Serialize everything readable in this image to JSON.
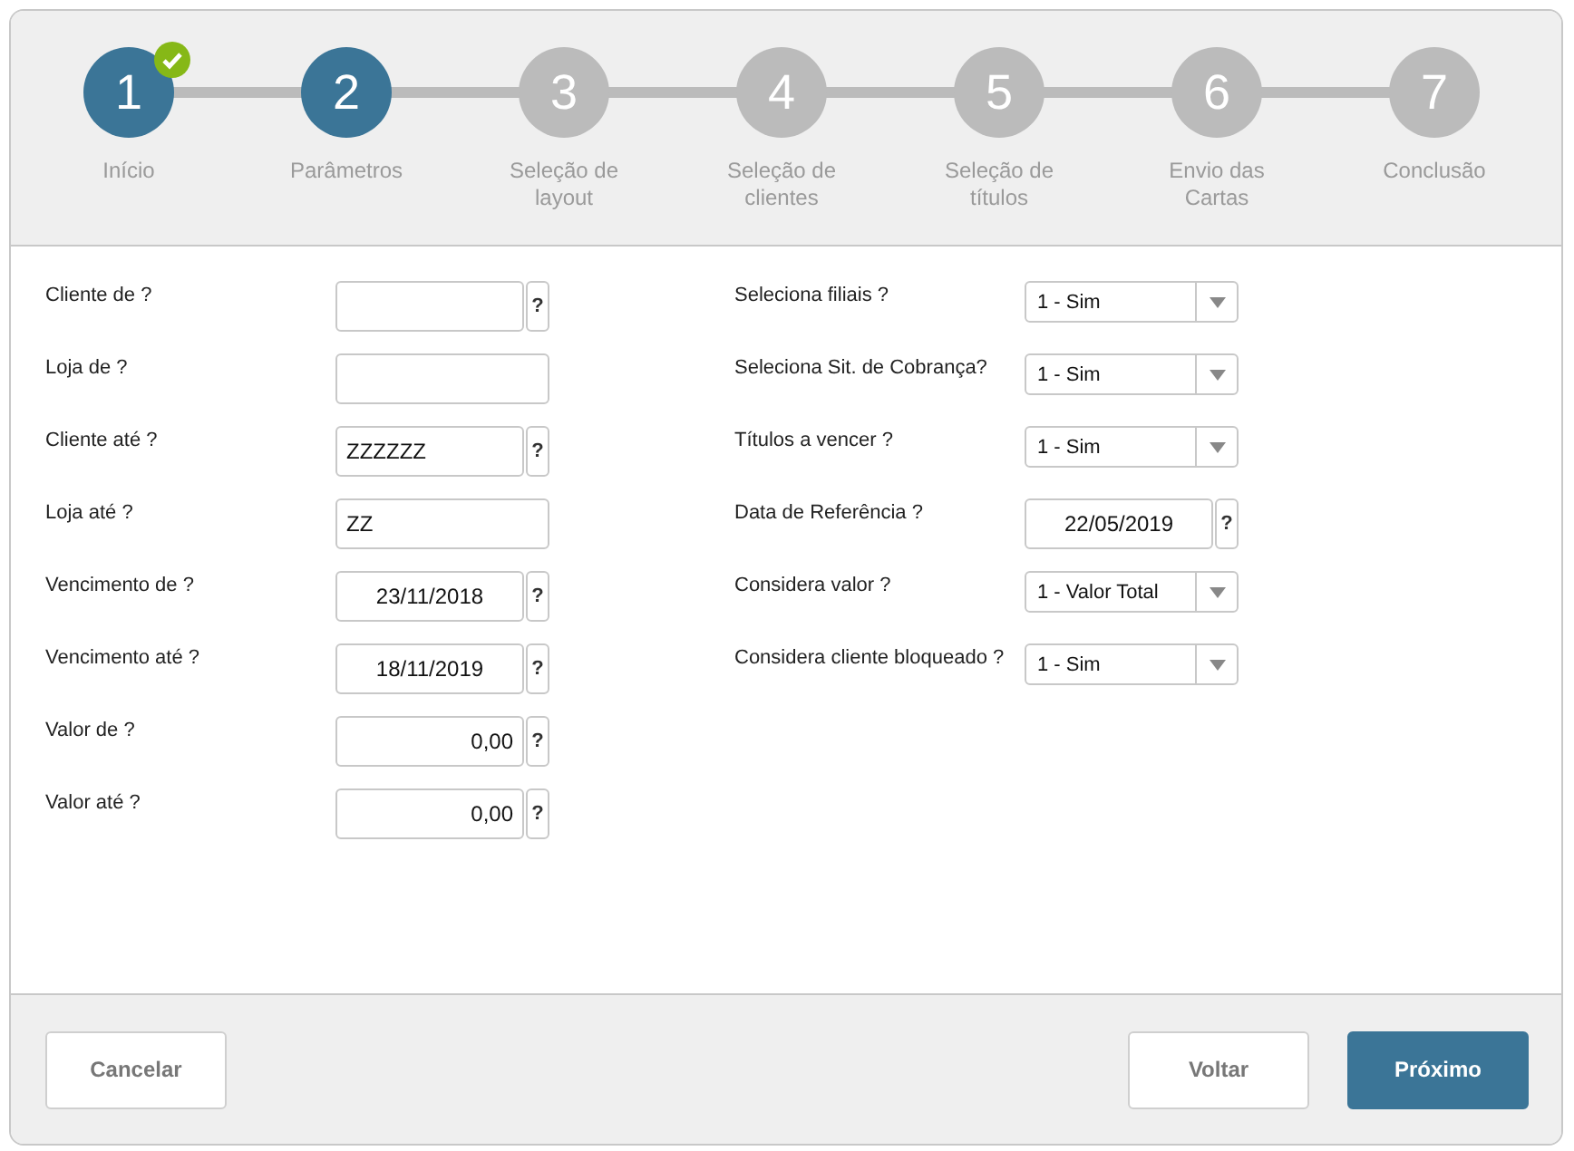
{
  "steps": [
    {
      "number": "1",
      "label": "Início",
      "reached": true,
      "completed": true
    },
    {
      "number": "2",
      "label": "Parâmetros",
      "reached": true,
      "completed": false
    },
    {
      "number": "3",
      "label": "Seleção de layout",
      "reached": false,
      "completed": false
    },
    {
      "number": "4",
      "label": "Seleção de clientes",
      "reached": false,
      "completed": false
    },
    {
      "number": "5",
      "label": "Seleção de títulos",
      "reached": false,
      "completed": false
    },
    {
      "number": "6",
      "label": "Envio das Cartas",
      "reached": false,
      "completed": false
    },
    {
      "number": "7",
      "label": "Conclusão",
      "reached": false,
      "completed": false
    }
  ],
  "form": {
    "left": [
      {
        "label": "Cliente de ?",
        "kind": "text",
        "help": "?"
      },
      {
        "label": "Loja de ?",
        "kind": "text"
      },
      {
        "label": "Cliente até ?",
        "kind": "text",
        "value": "ZZZZZZ",
        "help": "?"
      },
      {
        "label": "Loja até ?",
        "kind": "text",
        "value": "ZZ"
      },
      {
        "label": "Vencimento de ?",
        "kind": "date",
        "value": "23/11/2018",
        "help": "?"
      },
      {
        "label": "Vencimento até ?",
        "kind": "date",
        "value": "18/11/2019",
        "help": "?"
      },
      {
        "label": "Valor de ?",
        "kind": "number",
        "value": "0,00",
        "help": "?"
      },
      {
        "label": "Valor até ?",
        "kind": "number",
        "value": "0,00",
        "help": "?"
      }
    ],
    "right": [
      {
        "label": "Seleciona filiais ?",
        "kind": "select",
        "value": "1 - Sim"
      },
      {
        "label": "Seleciona Sit. de Cobrança?",
        "kind": "select",
        "value": "1 - Sim"
      },
      {
        "label": "Títulos a vencer ?",
        "kind": "select",
        "value": "1 - Sim"
      },
      {
        "label": "Data de Referência ?",
        "kind": "date",
        "value": "22/05/2019",
        "help": "?"
      },
      {
        "label": "Considera valor ?",
        "kind": "select",
        "value": "1 - Valor Total"
      },
      {
        "label": "Considera cliente bloqueado ?",
        "kind": "select",
        "value": "1 - Sim"
      }
    ]
  },
  "footer": {
    "left": [
      {
        "label": "Cancelar",
        "kind": "secondary"
      }
    ],
    "right": [
      {
        "label": "Voltar",
        "kind": "secondary"
      },
      {
        "label": "Próximo",
        "kind": "primary"
      }
    ]
  }
}
